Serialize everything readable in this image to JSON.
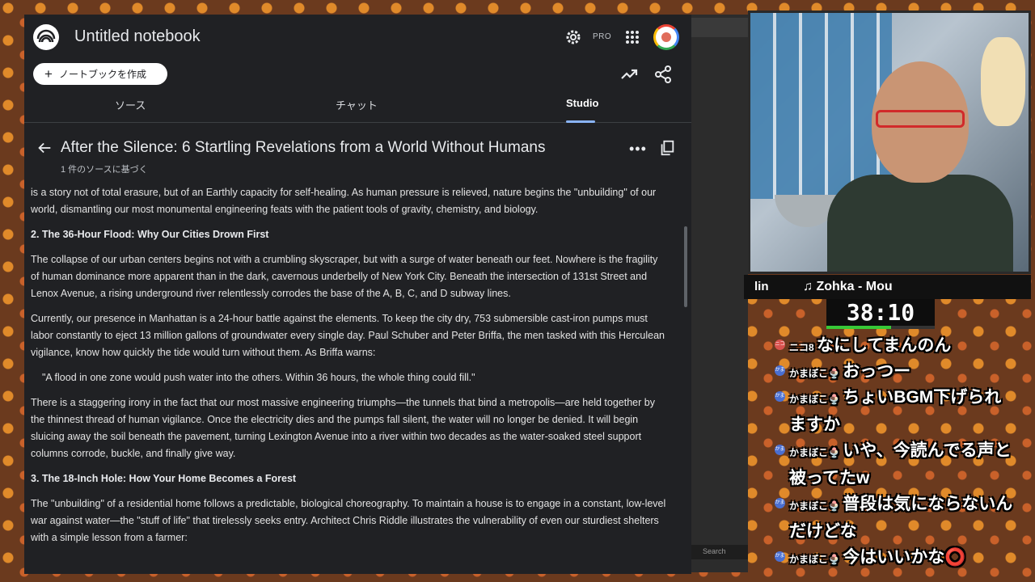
{
  "notebook": {
    "title": "Untitled notebook",
    "pro_label": "PRO",
    "create_button": "ノートブックを作成",
    "tabs": [
      "ソース",
      "チャット",
      "Studio"
    ],
    "active_tab": "Studio"
  },
  "document": {
    "title": "After the Silence: 6 Startling Revelations from a World Without Humans",
    "subtitle": "1 件のソースに基づく",
    "paragraphs": [
      "is a story not of total erasure, but of an Earthly capacity for self-healing. As human pressure is relieved, nature begins the \"unbuilding\" of our world, dismantling our most monumental engineering feats with the patient tools of gravity, chemistry, and biology.",
      "2. The 36-Hour Flood: Why Our Cities Drown First",
      "The collapse of our urban centers begins not with a crumbling skyscraper, but with a surge of water beneath our feet. Nowhere is the fragility of human dominance more apparent than in the dark, cavernous underbelly of New York City. Beneath the intersection of 131st Street and Lenox Avenue, a rising underground river relentlessly corrodes the base of the A, B, C, and D subway lines.",
      "Currently, our presence in Manhattan is a 24-hour battle against the elements. To keep the city dry, 753 submersible cast-iron pumps must labor constantly to eject 13 million gallons of groundwater every single day. Paul Schuber and Peter Briffa, the men tasked with this Herculean vigilance, know how quickly the tide would turn without them. As Briffa warns:",
      "\"A flood in one zone would push water into the others. Within 36 hours, the whole thing could fill.\"",
      "There is a staggering irony in the fact that our most massive engineering triumphs—the tunnels that bind a metropolis—are held together by the thinnest thread of human vigilance. Once the electricity dies and the pumps fall silent, the water will no longer be denied. It will begin sluicing away the soil beneath the pavement, turning Lexington Avenue into a river within two decades as the water-soaked steel support columns corrode, buckle, and finally give way.",
      "3. The 18-Inch Hole: How Your Home Becomes a Forest",
      "The \"unbuilding\" of a residential home follows a predictable, biological choreography. To maintain a house is to engage in a constant, low-level war against water—the \"stuff of life\" that tirelessly seeks entry. Architect Chris Riddle illustrates the vulnerability of even our sturdiest shelters with a simple lesson from a farmer:"
    ]
  },
  "overlay": {
    "music_prefix": "lin",
    "music_title": "♫ Zohka - Mou",
    "timer": "38:10",
    "timer_progress": 0.6,
    "search_placeholder": "Search",
    "chat": [
      {
        "badge": "ニコ",
        "name": "ニコ8",
        "text": "なにしてまんのん"
      },
      {
        "badge": "かま",
        "name": "かまぼこ🍨",
        "text": "おっつー"
      },
      {
        "badge": "かま",
        "name": "かまぼこ🍨",
        "text": "ちょいBGM下げられますか"
      },
      {
        "badge": "かま",
        "name": "かまぼこ🍨",
        "text": "いや、今読んでる声と被ってたw"
      },
      {
        "badge": "かま",
        "name": "かまぼこ🍨",
        "text": "普段は気にならないんだけどな"
      },
      {
        "badge": "かま",
        "name": "かまぼこ🍨",
        "text": "今はいいかな⭕"
      }
    ]
  }
}
